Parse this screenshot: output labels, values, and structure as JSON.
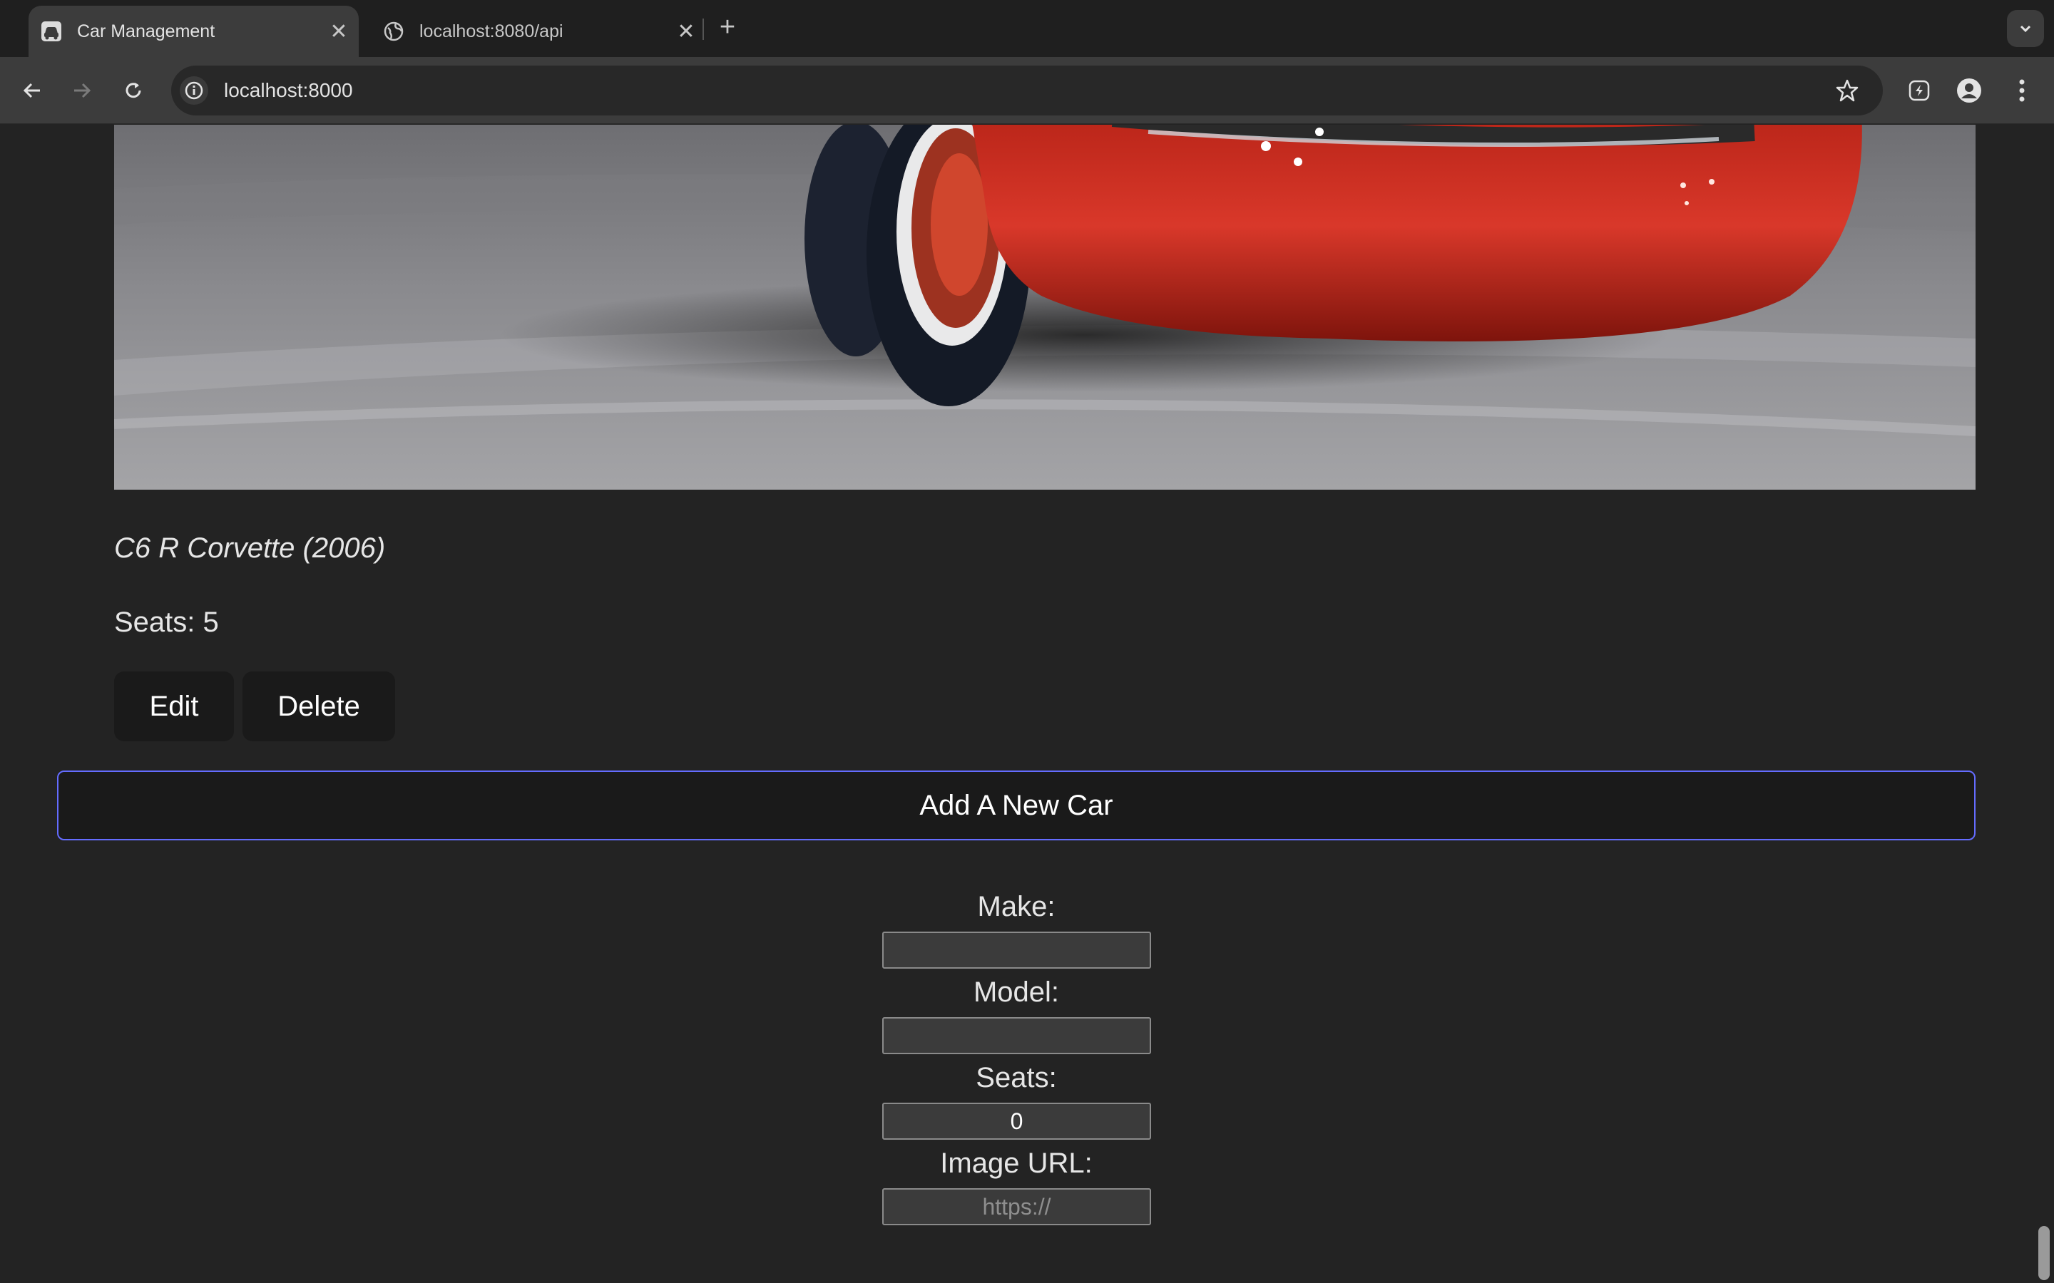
{
  "browser": {
    "tabs": [
      {
        "title": "Car Management",
        "active": true,
        "icon": "car-favicon"
      },
      {
        "title": "localhost:8080/api",
        "active": false,
        "icon": "globe-icon"
      }
    ],
    "url": "localhost:8000"
  },
  "page": {
    "car": {
      "caption": "C6 R Corvette (2006)",
      "seats_text": "Seats: 5",
      "edit_label": "Edit",
      "delete_label": "Delete"
    },
    "add_new_label": "Add A New Car",
    "form": {
      "make_label": "Make:",
      "make_value": "",
      "model_label": "Model:",
      "model_value": "",
      "seats_label": "Seats:",
      "seats_value": "0",
      "image_url_label": "Image URL:",
      "image_url_placeholder": "https://"
    }
  },
  "colors": {
    "page_bg": "#232323",
    "button_bg": "#1a1a1a",
    "accent_border": "#646cff",
    "car_red": "#c62a1f"
  }
}
